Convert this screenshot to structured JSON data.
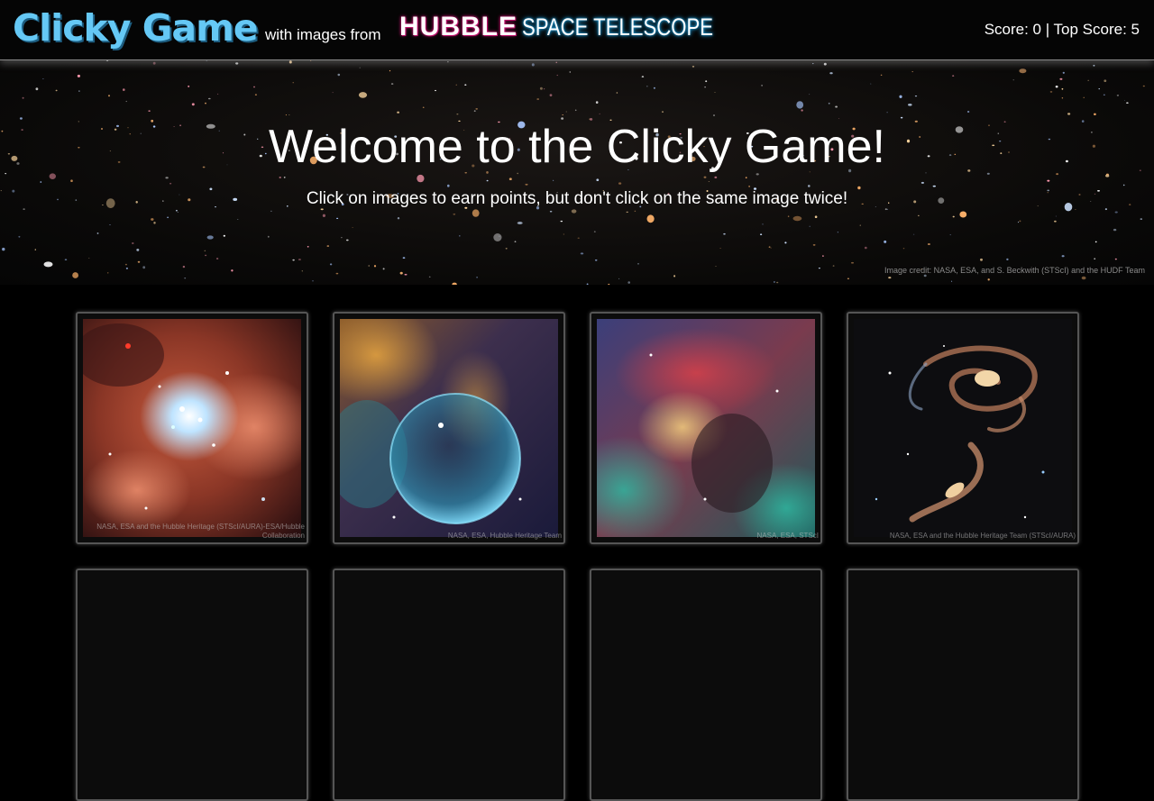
{
  "header": {
    "title": "Clicky Game",
    "with_text": "with images from",
    "logo_word1": "HUBBLE",
    "logo_word2": "SPACE TELESCOPE",
    "score_text": "Score: 0 | Top Score: 5",
    "score": 0,
    "top_score": 5
  },
  "hero": {
    "title": "Welcome to the Clicky Game!",
    "subtitle": "Click on images to earn points, but don't click on the same image twice!",
    "credit": "Image credit: NASA, ESA, and S. Beckwith (STScI) and the HUDF Team"
  },
  "cards": [
    {
      "caption": "NASA, ESA and the Hubble Heritage (STScI/AURA)-ESA/Hubble Collaboration",
      "image": "star-cluster-nebula"
    },
    {
      "caption": "NASA, ESA, Hubble Heritage Team",
      "image": "bubble-nebula"
    },
    {
      "caption": "NASA, ESA, STScI",
      "image": "lagoon-nebula"
    },
    {
      "caption": "NASA, ESA and the Hubble Heritage Team (STScI/AURA)",
      "image": "interacting-galaxies"
    }
  ],
  "colors": {
    "brand": "#65c8f5",
    "logo_glow_pink": "#c0146e",
    "logo_glow_blue": "#1ea7e8",
    "background": "#000000"
  }
}
